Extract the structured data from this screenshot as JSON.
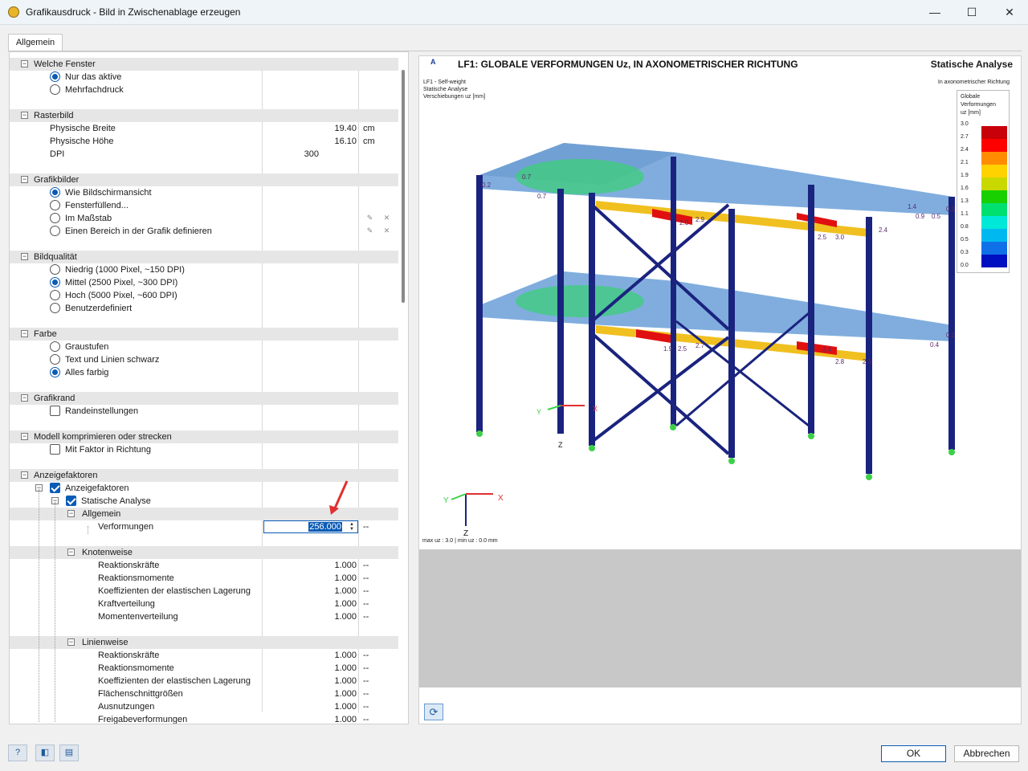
{
  "window": {
    "title": "Grafikausdruck - Bild in Zwischenablage erzeugen",
    "min": "—",
    "max": "☐",
    "close": "✕"
  },
  "tabs": [
    {
      "label": "Allgemein"
    }
  ],
  "sections": {
    "welche_fenster": {
      "title": "Welche Fenster",
      "options": [
        "Nur das aktive",
        "Mehrfachdruck"
      ],
      "selected": 0
    },
    "rasterbild": {
      "title": "Rasterbild",
      "rows": [
        {
          "label": "Physische Breite",
          "value": "19.40",
          "unit": "cm"
        },
        {
          "label": "Physische Höhe",
          "value": "16.10",
          "unit": "cm"
        },
        {
          "label": "DPI",
          "value": "300",
          "unit": ""
        }
      ]
    },
    "grafikbilder": {
      "title": "Grafikbilder",
      "options": [
        "Wie Bildschirmansicht",
        "Fensterfüllend...",
        "Im Maßstab",
        "Einen Bereich in der Grafik definieren"
      ],
      "selected": 0
    },
    "bildqualitaet": {
      "title": "Bildqualität",
      "options": [
        "Niedrig (1000 Pixel, ~150 DPI)",
        "Mittel (2500 Pixel, ~300 DPI)",
        "Hoch (5000 Pixel, ~600 DPI)",
        "Benutzerdefiniert"
      ],
      "selected": 1
    },
    "farbe": {
      "title": "Farbe",
      "options": [
        "Graustufen",
        "Text und Linien schwarz",
        "Alles farbig"
      ],
      "selected": 2
    },
    "grafikrand": {
      "title": "Grafikrand",
      "check": "Randeinstellungen"
    },
    "modell": {
      "title": "Modell komprimieren oder strecken",
      "check": "Mit Faktor in Richtung"
    },
    "anzeigefaktoren": {
      "title": "Anzeigefaktoren",
      "l1": "Anzeigefaktoren",
      "l2": "Statische Analyse",
      "allgemein": "Allgemein",
      "verformungen": {
        "label": "Verformungen",
        "value": "256.000",
        "unit": "--"
      },
      "knotenweise": {
        "title": "Knotenweise",
        "rows": [
          {
            "label": "Reaktionskräfte",
            "value": "1.000",
            "unit": "--"
          },
          {
            "label": "Reaktionsmomente",
            "value": "1.000",
            "unit": "--"
          },
          {
            "label": "Koeffizienten der elastischen Lagerung",
            "value": "1.000",
            "unit": "--"
          },
          {
            "label": "Kraftverteilung",
            "value": "1.000",
            "unit": "--"
          },
          {
            "label": "Momentenverteilung",
            "value": "1.000",
            "unit": "--"
          }
        ]
      },
      "linienweise": {
        "title": "Linienweise",
        "rows": [
          {
            "label": "Reaktionskräfte",
            "value": "1.000",
            "unit": "--"
          },
          {
            "label": "Reaktionsmomente",
            "value": "1.000",
            "unit": "--"
          },
          {
            "label": "Koeffizienten der elastischen Lagerung",
            "value": "1.000",
            "unit": "--"
          },
          {
            "label": "Flächenschnittgrößen",
            "value": "1.000",
            "unit": "--"
          },
          {
            "label": "Ausnutzungen",
            "value": "1.000",
            "unit": "--"
          },
          {
            "label": "Freigabeverformungen",
            "value": "1.000",
            "unit": "--"
          }
        ]
      }
    }
  },
  "preview": {
    "marker": "A",
    "title": "LF1: GLOBALE VERFORMUNGEN Uz, IN AXONOMETRISCHER RICHTUNG",
    "right_title": "Statische Analyse",
    "info": [
      "LF1 - Self-weight",
      "Statische Analyse",
      "Verschiebungen uz [mm]"
    ],
    "direction": "In axonometrischer Richtung",
    "legend": {
      "title": [
        "Globale",
        "Verformungen",
        "uz [mm]"
      ],
      "values": [
        "3.0",
        "2.7",
        "2.4",
        "2.1",
        "1.9",
        "1.6",
        "1.3",
        "1.1",
        "0.8",
        "0.5",
        "0.3",
        "0.0"
      ],
      "colors": [
        "#c8000a",
        "#ff0000",
        "#ff8c00",
        "#ffd200",
        "#c8d800",
        "#18d000",
        "#00e070",
        "#00e8d8",
        "#00b8f0",
        "#1070e8",
        "#0010c0"
      ]
    },
    "axis": {
      "x": "X",
      "y": "Y",
      "z": "Z"
    },
    "maxmin": "max uz : 3.0 | min uz : 0.0 mm",
    "labels": [
      "0.2",
      "0.7",
      "0.7",
      "2.6",
      "2.9",
      "2.5",
      "3.0",
      "2.4",
      "1.4",
      "0.9",
      "0.5",
      "0.3",
      "1.9",
      "2.5",
      "2.7",
      "2.4",
      "2.8",
      "2.3",
      "0.4",
      "0.2"
    ]
  },
  "footer": {
    "ok": "OK",
    "cancel": "Abbrechen"
  }
}
